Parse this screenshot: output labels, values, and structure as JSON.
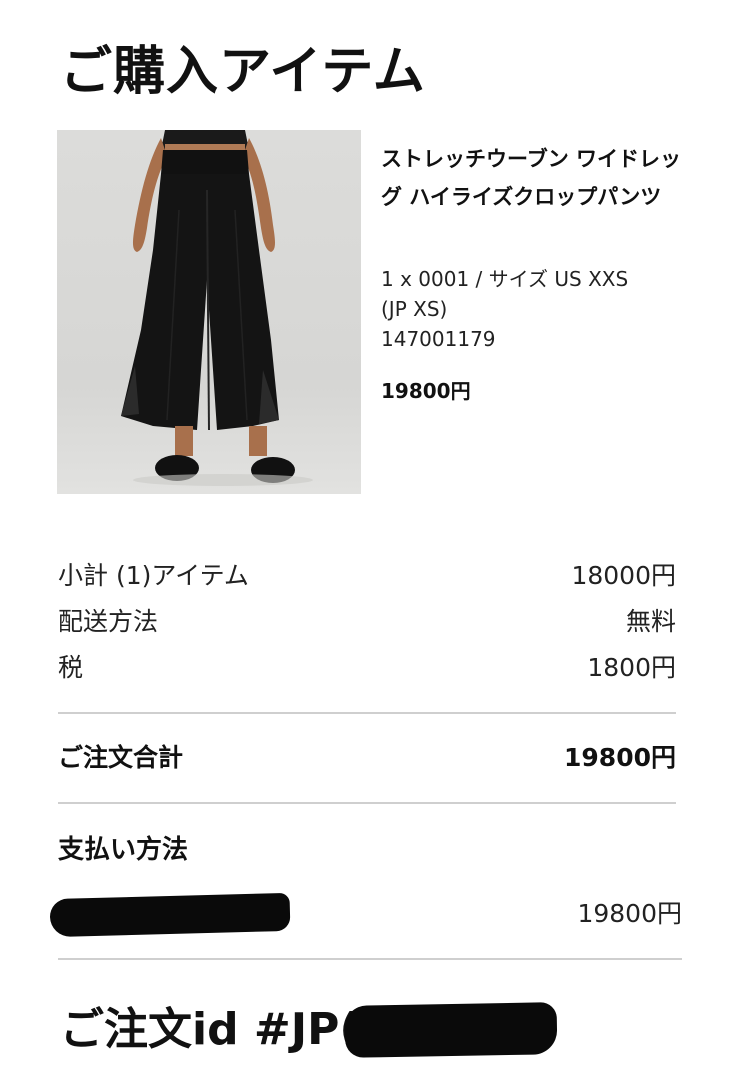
{
  "page_title": "ご購入アイテム",
  "product": {
    "name": "ストレッチウーブン ワイドレッグ ハイライズクロップパンツ",
    "variant_line": "1 x 0001 / サイズ US XXS",
    "variant_line2": "(JP XS)",
    "sku": "147001179",
    "price": "19800円"
  },
  "summary": {
    "subtotal_label": "小計 (1)アイテム",
    "subtotal_value": "18000円",
    "shipping_label": "配送方法",
    "shipping_value": "無料",
    "tax_label": "税",
    "tax_value": "1800円",
    "total_label": "ご注文合計",
    "total_value": "19800円"
  },
  "payment": {
    "heading": "支払い方法",
    "amount": "19800円"
  },
  "order": {
    "id_prefix": "ご注文id #JP("
  },
  "colors": {
    "text": "#111111",
    "divider": "#cfcfcf",
    "redaction": "#0a0a0a",
    "image_bg": "#d8d8d6"
  }
}
